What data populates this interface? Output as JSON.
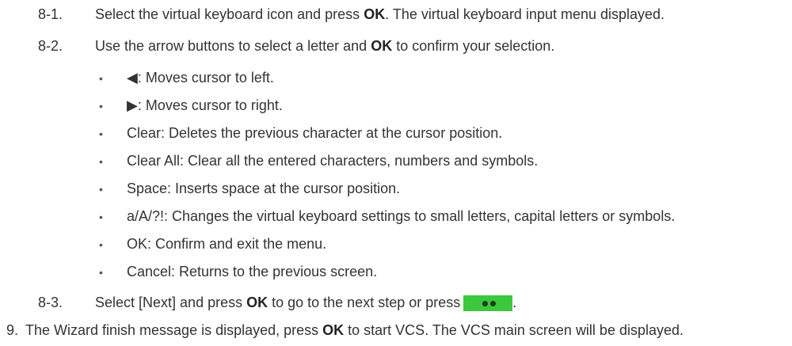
{
  "steps": [
    {
      "num": "8-1.",
      "text_before": "Select the virtual keyboard icon and press ",
      "bold": "OK",
      "text_after": ". The virtual keyboard input menu displayed."
    },
    {
      "num": "8-2.",
      "text_before": "Use the arrow buttons to select a letter and ",
      "bold": "OK",
      "text_after": " to confirm your selection."
    }
  ],
  "bullets": [
    {
      "glyph": "◀",
      "text": ": Moves cursor to left."
    },
    {
      "glyph": "▶",
      "text": ": Moves cursor to right."
    },
    {
      "glyph": "",
      "text": "Clear: Deletes the previous character at the cursor position."
    },
    {
      "glyph": "",
      "text": "Clear All: Clear all the entered characters, numbers and symbols."
    },
    {
      "glyph": "",
      "text": "Space: Inserts space at the cursor position."
    },
    {
      "glyph": "",
      "text": "a/A/?!: Changes the virtual keyboard settings to small letters, capital letters or symbols."
    },
    {
      "glyph": "",
      "text": "OK: Confirm and exit the menu."
    },
    {
      "glyph": "",
      "text": "Cancel: Returns to the previous screen."
    }
  ],
  "bullet_marker": "•",
  "step83": {
    "num": "8-3.",
    "text_before": "Select [Next] and press ",
    "bold": "OK",
    "text_after": " to go to the next step or press",
    "end": "."
  },
  "step9": {
    "num": "9.",
    "text_before": "The Wizard finish message is displayed, press ",
    "bold": "OK",
    "text_after": " to start VCS. The VCS main screen will be displayed."
  },
  "colors": {
    "green_button": "#3cc83c"
  },
  "icons": {
    "green_button_icon": "green-dot-dot-button-icon"
  }
}
